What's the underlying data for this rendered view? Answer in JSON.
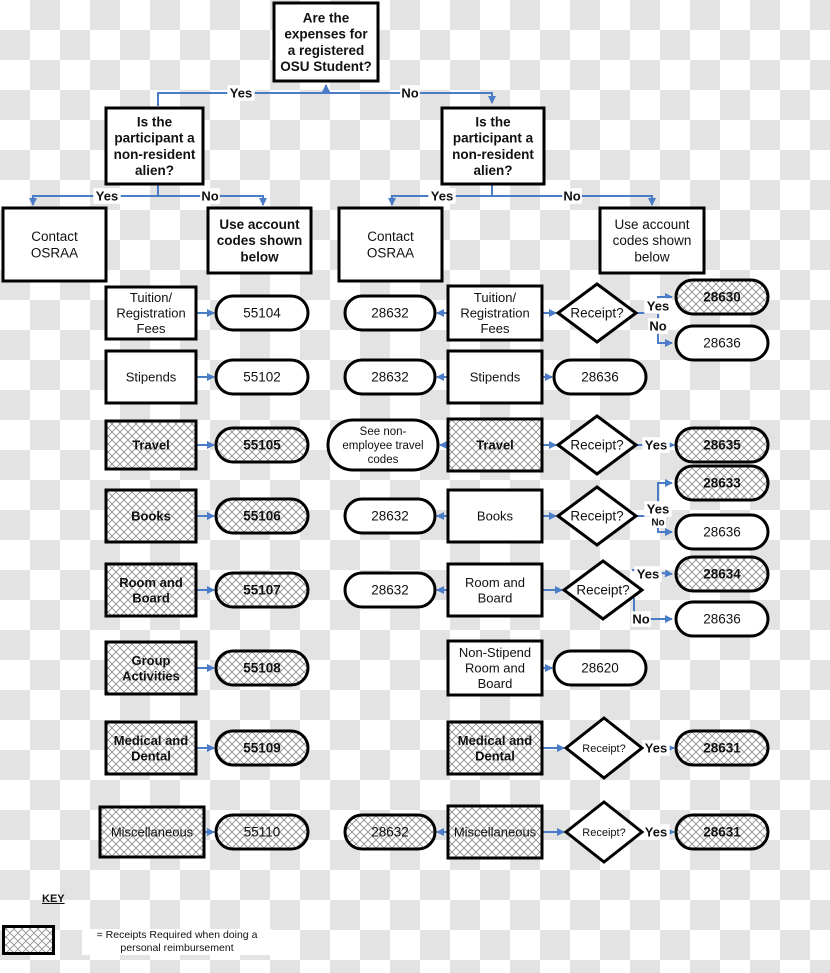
{
  "colors": {
    "arrow": "#4a7cc7",
    "stroke": "#000000",
    "hatch": "#8a8a8a",
    "fill": "#ffffff"
  },
  "flowchart": {
    "root": {
      "text": [
        "Are the",
        "expenses for",
        "a registered",
        "OSU Student?"
      ]
    },
    "root_yes": "Yes",
    "root_no": "No",
    "left": {
      "question": [
        "Is the",
        "participant a",
        "non-resident",
        "alien?"
      ],
      "yes": "Yes",
      "no": "No",
      "contact": [
        "Contact",
        "OSRAA"
      ],
      "use_codes": [
        "Use account",
        "codes shown",
        "below"
      ],
      "rows": [
        {
          "category": [
            "Tuition/",
            "Registration",
            "Fees"
          ],
          "code": "55104",
          "receipt_required": false
        },
        {
          "category": [
            "Stipends"
          ],
          "code": "55102",
          "receipt_required": false
        },
        {
          "category": [
            "Travel"
          ],
          "code": "55105",
          "receipt_required": true
        },
        {
          "category": [
            "Books"
          ],
          "code": "55106",
          "receipt_required": true
        },
        {
          "category": [
            "Room and",
            "Board"
          ],
          "code": "55107",
          "receipt_required": true
        },
        {
          "category": [
            "Group",
            "Activities"
          ],
          "code": "55108",
          "receipt_required": true
        },
        {
          "category": [
            "Medical and",
            "Dental"
          ],
          "code": "55109",
          "receipt_required": true
        },
        {
          "category": [
            "Miscellaneous"
          ],
          "code": "55110",
          "receipt_required": true
        }
      ]
    },
    "right": {
      "question": [
        "Is the",
        "participant a",
        "non-resident",
        "alien?"
      ],
      "yes": "Yes",
      "no": "No",
      "contact": [
        "Contact",
        "OSRAA"
      ],
      "use_codes": [
        "Use account",
        "codes shown",
        "below"
      ],
      "decision_label": "Receipt?",
      "rows": [
        {
          "category": [
            "Tuition/",
            "Registration",
            "Fees"
          ],
          "receipt_required": false,
          "left_code": [
            "28632"
          ],
          "direct_code": null,
          "receipt_yes": "28630",
          "receipt_no": "28636"
        },
        {
          "category": [
            "Stipends"
          ],
          "receipt_required": false,
          "left_code": [
            "28632"
          ],
          "direct_code": "28636",
          "receipt_yes": null,
          "receipt_no": null
        },
        {
          "category": [
            "Travel"
          ],
          "receipt_required": true,
          "left_code": [
            "See non-",
            "employee travel",
            "codes"
          ],
          "direct_code": null,
          "receipt_yes": "28635",
          "receipt_no": null
        },
        {
          "category": [
            "Books"
          ],
          "receipt_required": false,
          "left_code": [
            "28632"
          ],
          "direct_code": null,
          "receipt_yes": "28633",
          "receipt_no": "28636"
        },
        {
          "category": [
            "Room and",
            "Board"
          ],
          "receipt_required": false,
          "left_code": [
            "28632"
          ],
          "direct_code": null,
          "receipt_yes": "28634",
          "receipt_no": "28636"
        },
        {
          "category": [
            "Non-Stipend",
            "Room and",
            "Board"
          ],
          "receipt_required": false,
          "left_code": null,
          "direct_code": "28620",
          "receipt_yes": null,
          "receipt_no": null
        },
        {
          "category": [
            "Medical and",
            "Dental"
          ],
          "receipt_required": true,
          "left_code": null,
          "direct_code": null,
          "receipt_yes": "28631",
          "receipt_no": null
        },
        {
          "category": [
            "Miscellaneous"
          ],
          "receipt_required": true,
          "left_code": [
            "28632"
          ],
          "direct_code": null,
          "receipt_yes": "28631",
          "receipt_no": null
        }
      ],
      "yes_label": "Yes",
      "no_label": "No"
    }
  },
  "key": {
    "title": "KEY",
    "description": "= Receipts Required when doing a personal reimbursement"
  }
}
